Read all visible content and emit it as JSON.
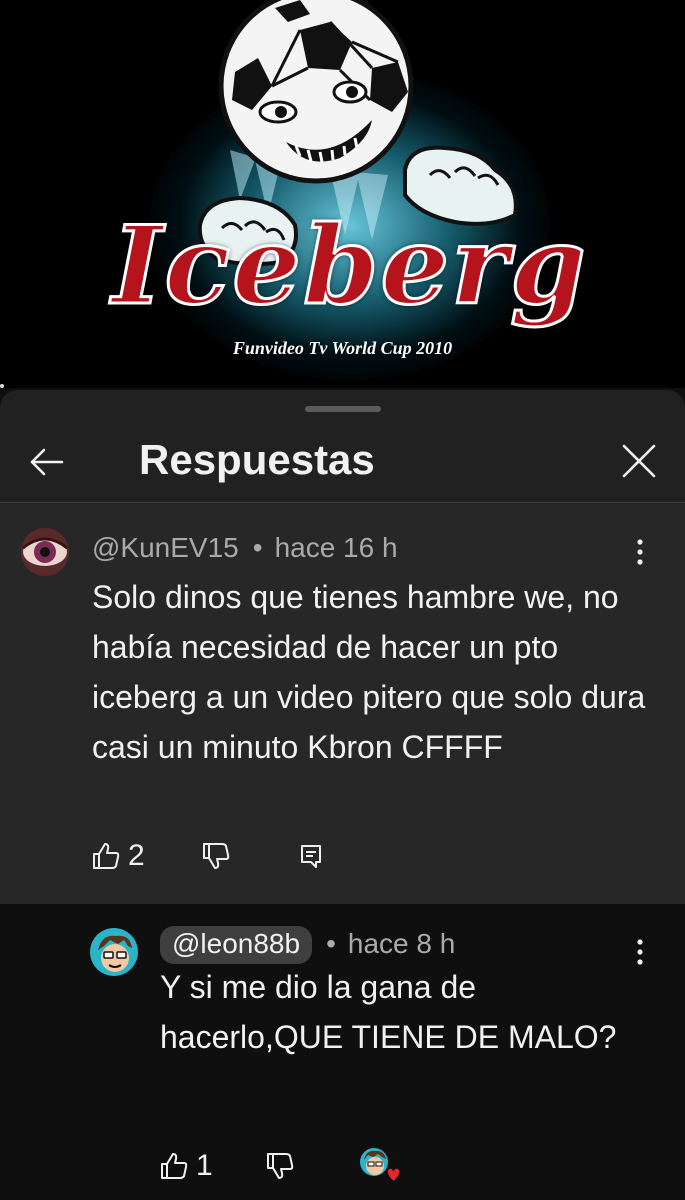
{
  "thumbnail": {
    "logo_word": "Iceberg",
    "logo_subtitle": "Funvideo Tv World Cup 2010"
  },
  "panel": {
    "title": "Respuestas",
    "back_icon": "arrow-left-icon",
    "close_icon": "close-icon"
  },
  "comments": [
    {
      "author": "@KunEV15",
      "time": "hace 16 h",
      "text": "Solo dinos que tienes hambre we, no había necesidad de hacer un pto iceberg a un video pitero que solo dura casi un minuto Kbron CFFFF",
      "likes": "2",
      "author_highlighted": false
    },
    {
      "author": "@leon88b",
      "time": "hace 8 h",
      "text": "Y si me dio la gana de hacerlo,QUE TIENE DE MALO?",
      "likes": "1",
      "author_highlighted": true,
      "creator_heart": true
    }
  ],
  "colors": {
    "panel_bg": "#212121",
    "highlight_bg": "#272727",
    "logo_red": "#b5141c",
    "heart_red": "#e5262a"
  }
}
